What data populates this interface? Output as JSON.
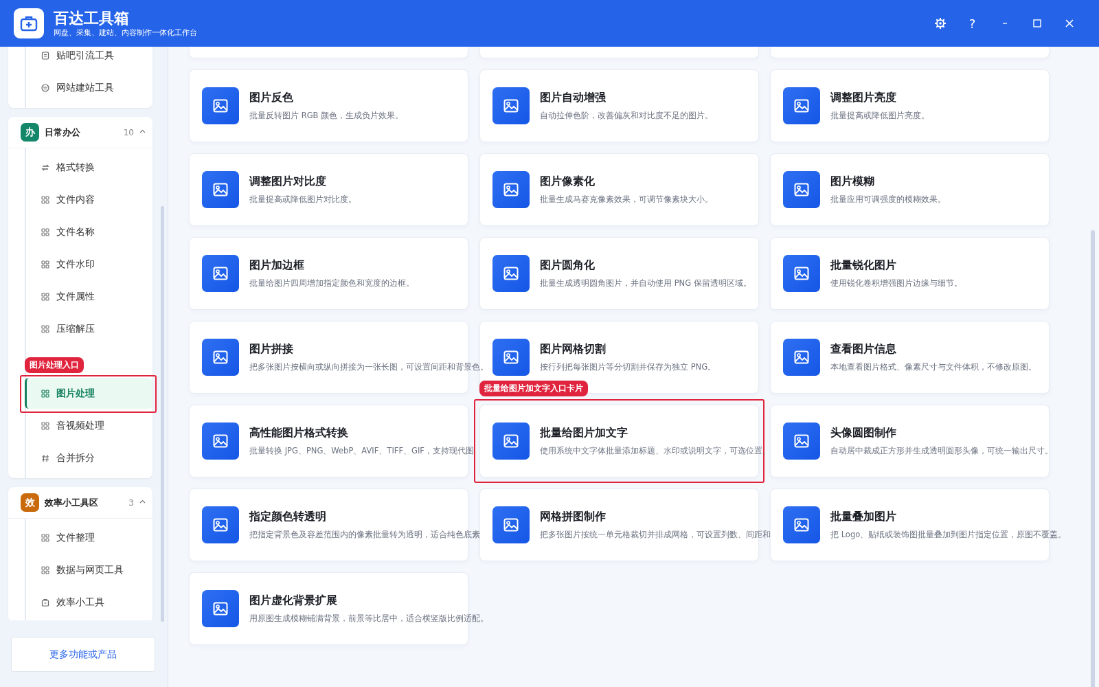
{
  "app": {
    "title": "百达工具箱",
    "subtitle": "网盘、采集、建站、内容制作一体化工作台"
  },
  "window_controls": [
    {
      "kind": "settings"
    },
    {
      "kind": "help",
      "label": "?"
    },
    {
      "kind": "minimize"
    },
    {
      "kind": "maximize"
    },
    {
      "kind": "close"
    }
  ],
  "sidebar": {
    "groups": [
      {
        "items": [
          {
            "kind": "doc",
            "label": "贴吧引流工具",
            "selected": false
          },
          {
            "kind": "globe",
            "label": "网站建站工具",
            "selected": false
          }
        ]
      },
      {
        "badge": "办",
        "color": "#14876a",
        "title": "日常办公",
        "count": "10",
        "expanded": true,
        "items": [
          {
            "kind": "swap",
            "label": "格式转换",
            "selected": false
          },
          {
            "kind": "grid",
            "label": "文件内容",
            "selected": false
          },
          {
            "kind": "grid",
            "label": "文件名称",
            "selected": false
          },
          {
            "kind": "grid",
            "label": "文件水印",
            "selected": false
          },
          {
            "kind": "grid",
            "label": "文件属性",
            "selected": false
          },
          {
            "kind": "grid",
            "label": "压缩解压",
            "selected": false
          },
          {
            "kind": "hidden"
          },
          {
            "kind": "grid",
            "label": "图片处理",
            "selected": true,
            "annotation": "图片处理入口"
          },
          {
            "kind": "grid",
            "label": "音视频处理",
            "selected": false
          },
          {
            "kind": "hash",
            "label": "合并拆分",
            "selected": false
          }
        ]
      },
      {
        "badge": "效",
        "color": "#c96a0c",
        "title": "效率小工具区",
        "count": "3",
        "expanded": true,
        "items": [
          {
            "kind": "grid",
            "label": "文件整理",
            "selected": false
          },
          {
            "kind": "grid",
            "label": "数据与网页工具",
            "selected": false
          },
          {
            "kind": "box",
            "label": "效率小工具",
            "selected": false
          }
        ]
      }
    ],
    "more_button": "更多功能或产品"
  },
  "tools": [
    {
      "title": "图片反色",
      "description": "批量反转图片 RGB 颜色，生成负片效果。"
    },
    {
      "title": "图片自动增强",
      "description": "自动拉伸色阶，改善偏灰和对比度不足的图片。"
    },
    {
      "title": "调整图片亮度",
      "description": "批量提高或降低图片亮度。"
    },
    {
      "title": "调整图片对比度",
      "description": "批量提高或降低图片对比度。"
    },
    {
      "title": "图片像素化",
      "description": "批量生成马赛克像素效果，可调节像素块大小。"
    },
    {
      "title": "图片模糊",
      "description": "批量应用可调强度的模糊效果。"
    },
    {
      "title": "图片加边框",
      "description": "批量给图片四周增加指定颜色和宽度的边框。"
    },
    {
      "title": "图片圆角化",
      "description": "批量生成透明圆角图片，并自动使用 PNG 保留透明区域。"
    },
    {
      "title": "批量锐化图片",
      "description": "使用锐化卷积增强图片边缘与细节。"
    },
    {
      "title": "图片拼接",
      "description": "把多张图片按横向或纵向拼接为一张长图，可设置间距和背景色。"
    },
    {
      "title": "图片网格切割",
      "description": "按行列把每张图片等分切割并保存为独立 PNG。"
    },
    {
      "title": "查看图片信息",
      "description": "本地查看图片格式、像素尺寸与文件体积，不修改原图。"
    },
    {
      "title": "高性能图片格式转换",
      "description": "批量转换 JPG、PNG、WebP、AVIF、TIFF、GIF，支持现代图"
    },
    {
      "title": "批量给图片加文字",
      "description": "使用系统中文字体批量添加标题、水印或说明文字，可选位置、",
      "annotation": "批量给图片加文字入口卡片"
    },
    {
      "title": "头像圆图制作",
      "description": "自动居中裁成正方形并生成透明圆形头像，可统一输出尺寸。"
    },
    {
      "title": "指定颜色转透明",
      "description": "把指定背景色及容差范围内的像素批量转为透明，适合纯色底素"
    },
    {
      "title": "网格拼图制作",
      "description": "把多张图片按统一单元格裁切并排成网格，可设置列数、间距和"
    },
    {
      "title": "批量叠加图片",
      "description": "把 Logo、贴纸或装饰图批量叠加到图片指定位置，原图不覆盖。"
    },
    {
      "title": "图片虚化背景扩展",
      "description": "用原图生成模糊铺满背景，前景等比居中，适合横竖版比例适配。"
    }
  ]
}
